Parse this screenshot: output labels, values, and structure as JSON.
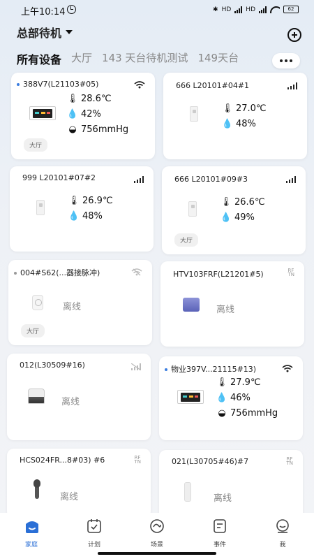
{
  "status_bar": {
    "time": "上午10:14",
    "network_label": "HD",
    "battery": "62"
  },
  "header": {
    "location": "总部待机"
  },
  "tabs": [
    {
      "label": "所有设备",
      "active": true
    },
    {
      "label": "大厅"
    },
    {
      "label": "143 天台待机测试"
    },
    {
      "label": "149天台"
    }
  ],
  "devices": [
    {
      "name": "388V7(L21103#05)",
      "connection": "wifi",
      "temperature": "28.6℃",
      "humidity": "42%",
      "pressure": "756mmHg",
      "room": "大厅"
    },
    {
      "name": "666 L20101#04#1",
      "connection": "signal",
      "temperature": "27.0℃",
      "humidity": "48%"
    },
    {
      "name": "999 L20101#07#2",
      "connection": "signal",
      "temperature": "26.9℃",
      "humidity": "48%"
    },
    {
      "name": "666 L20101#09#3",
      "connection": "signal",
      "temperature": "26.6℃",
      "humidity": "49%",
      "room": "大厅"
    },
    {
      "name": "004#S62(...器接脉冲)",
      "connection": "wifi-off",
      "status": "离线",
      "room": "大厅"
    },
    {
      "name": "HTV103FRF(L21201#5)",
      "connection": "rf",
      "status": "离线"
    },
    {
      "name": "012(L30509#16)",
      "connection": "signal-off",
      "status": "离线"
    },
    {
      "name": "物业397V...21115#13)",
      "connection": "wifi",
      "temperature": "27.9℃",
      "humidity": "46%",
      "pressure": "756mmHg"
    },
    {
      "name": "HCS024FR...8#03) #6",
      "connection": "rf",
      "status": "离线"
    },
    {
      "name": "021(L30705#46)#7",
      "connection": "rf",
      "status": "离线"
    }
  ],
  "rf_label": {
    "top": "RF",
    "bottom": "TN"
  },
  "bottom_nav": [
    {
      "label": "家庭",
      "icon": "home-icon",
      "active": true
    },
    {
      "label": "计划",
      "icon": "schedule-icon"
    },
    {
      "label": "场景",
      "icon": "scene-icon"
    },
    {
      "label": "事件",
      "icon": "event-icon"
    },
    {
      "label": "我",
      "icon": "profile-icon"
    }
  ],
  "colors": {
    "accent": "#2a6fd6",
    "online_dot": "#3b7de0"
  }
}
